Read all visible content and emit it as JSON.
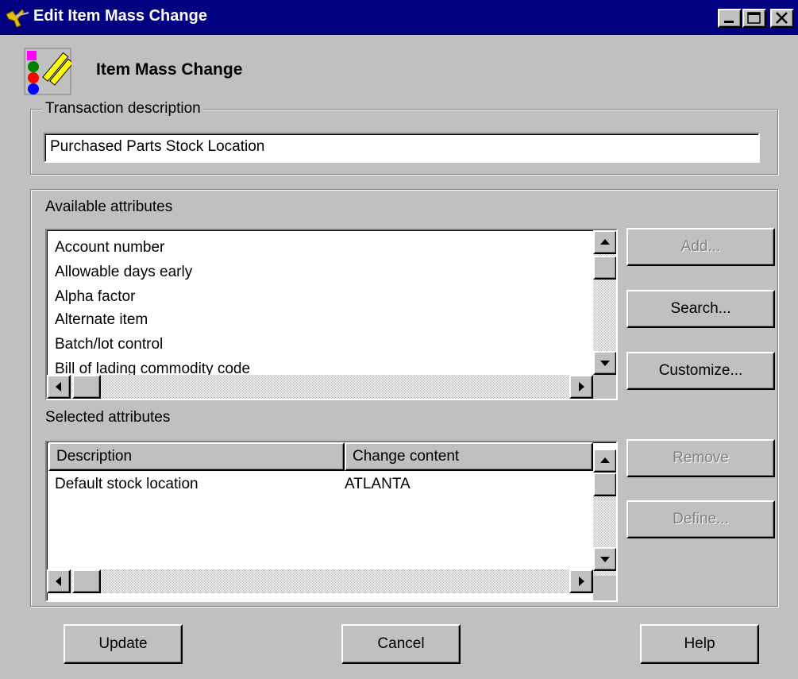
{
  "window": {
    "title": "Edit Item Mass Change",
    "controls": [
      "minimize",
      "maximize",
      "close"
    ]
  },
  "header": {
    "title": "Item Mass Change",
    "icon": "item-mass-change-icon"
  },
  "transaction": {
    "legend": "Transaction description",
    "value": "Purchased Parts Stock Location"
  },
  "available": {
    "label": "Available attributes",
    "items": [
      "Account number",
      "Allowable days early",
      "Alpha factor",
      "Alternate item",
      "Batch/lot control",
      "Bill of lading commodity code"
    ],
    "buttons": {
      "add": "Add...",
      "search": "Search...",
      "customize": "Customize..."
    },
    "button_states": {
      "add": "disabled",
      "search": "enabled",
      "customize": "enabled"
    }
  },
  "selected": {
    "label": "Selected attributes",
    "columns": [
      "Description",
      "Change content"
    ],
    "rows": [
      {
        "description": "Default stock location",
        "change_content": "ATLANTA"
      }
    ],
    "buttons": {
      "remove": "Remove",
      "define": "Define..."
    },
    "button_states": {
      "remove": "disabled",
      "define": "disabled"
    }
  },
  "footer": {
    "update": "Update",
    "cancel": "Cancel",
    "help": "Help"
  },
  "colors": {
    "titlebar": "#000080",
    "face": "#c0c0c0",
    "disabled_text": "#808080"
  }
}
